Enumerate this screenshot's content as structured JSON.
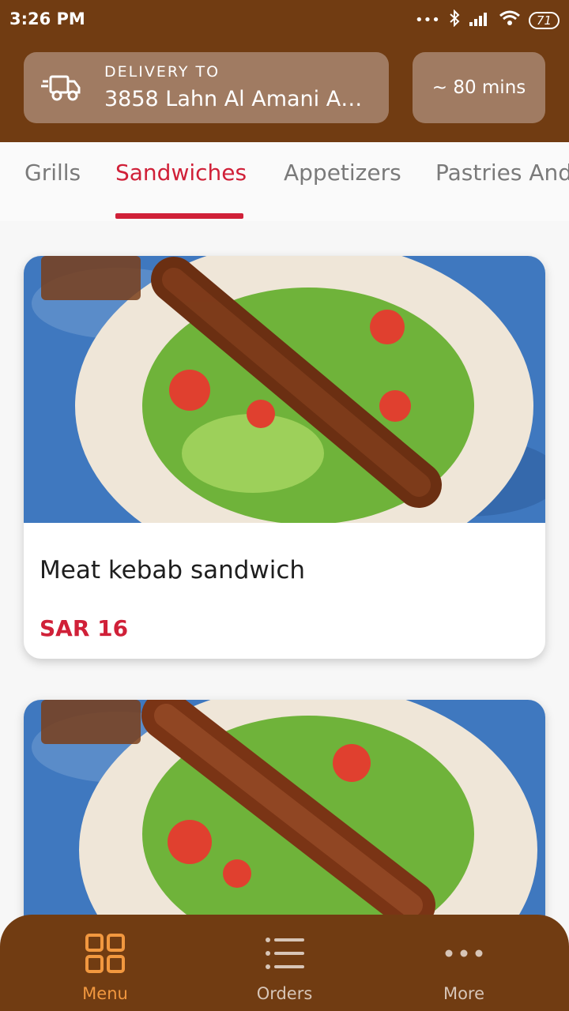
{
  "status_bar": {
    "time": "3:26 PM",
    "battery": "71"
  },
  "header": {
    "delivery_label": "DELIVERY TO",
    "delivery_address": "3858 Lahn Al Amani AR...",
    "eta": "~ 80 mins"
  },
  "tabs": [
    {
      "label": "Grills"
    },
    {
      "label": "Sandwiches",
      "active": true
    },
    {
      "label": "Appetizers"
    },
    {
      "label": "Pastries And"
    }
  ],
  "items": [
    {
      "name": "Meat kebab sandwich",
      "price": "SAR 16"
    },
    {
      "name": "",
      "price": ""
    }
  ],
  "bottom_nav": [
    {
      "label": "Menu",
      "icon": "grid-icon",
      "active": true
    },
    {
      "label": "Orders",
      "icon": "list-icon"
    },
    {
      "label": "More",
      "icon": "more-dots-icon"
    }
  ],
  "colors": {
    "brand": "#713c12",
    "accent": "#d02038",
    "active_nav": "#f2983f",
    "box": "#a07b62"
  }
}
